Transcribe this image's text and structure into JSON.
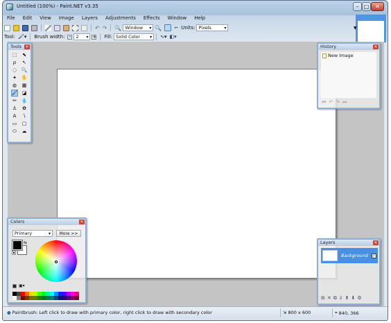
{
  "window": {
    "title": "Untitled (100%) - Paint.NET v3.35",
    "min_glyph": "–",
    "max_glyph": "□",
    "close_glyph": "✕"
  },
  "menubar": {
    "items": [
      "File",
      "Edit",
      "View",
      "Image",
      "Layers",
      "Adjustments",
      "Effects",
      "Window",
      "Help"
    ]
  },
  "toolbar1": {
    "zoom_value": "Window",
    "units_label": "Units:",
    "units_value": "Pixels"
  },
  "toolbar2": {
    "tool_label": "Tool:",
    "brush_width_label": "Brush width:",
    "brush_width_value": "2",
    "fill_label": "Fill:",
    "fill_value": "Solid Color"
  },
  "tools_panel": {
    "title": "Tools",
    "tools": [
      {
        "name": "rectangle-select-icon",
        "glyph": "⬚"
      },
      {
        "name": "move-selection-icon",
        "glyph": "⬉"
      },
      {
        "name": "lasso-select-icon",
        "glyph": "ρ"
      },
      {
        "name": "move-selection-alt-icon",
        "glyph": "↖"
      },
      {
        "name": "ellipse-select-icon",
        "glyph": "◌"
      },
      {
        "name": "zoom-icon",
        "glyph": "🔍"
      },
      {
        "name": "magic-wand-icon",
        "glyph": "✦"
      },
      {
        "name": "pan-icon",
        "glyph": "✋"
      },
      {
        "name": "paint-bucket-icon",
        "glyph": "◍"
      },
      {
        "name": "gradient-icon",
        "glyph": "▦"
      },
      {
        "name": "paintbrush-icon",
        "glyph": "🖌"
      },
      {
        "name": "eraser-icon",
        "glyph": "◪"
      },
      {
        "name": "pencil-icon",
        "glyph": "✏"
      },
      {
        "name": "color-picker-icon",
        "glyph": "💧"
      },
      {
        "name": "clone-stamp-icon",
        "glyph": "♙"
      },
      {
        "name": "recolor-icon",
        "glyph": "✿"
      },
      {
        "name": "text-icon",
        "glyph": "A"
      },
      {
        "name": "line-curve-icon",
        "glyph": "∖"
      },
      {
        "name": "rectangle-icon",
        "glyph": "▭"
      },
      {
        "name": "rounded-rectangle-icon",
        "glyph": "▢"
      },
      {
        "name": "ellipse-icon",
        "glyph": "⬭"
      },
      {
        "name": "freeform-shape-icon",
        "glyph": "☁"
      }
    ],
    "active_tool": "paintbrush-icon"
  },
  "history_panel": {
    "title": "History",
    "items": [
      "New Image"
    ]
  },
  "colors_panel": {
    "title": "Colors",
    "mode_value": "Primary",
    "more_label": "More >>",
    "primary_color": "#000000",
    "secondary_color": "#ffffff",
    "palette": [
      "#000000",
      "#404040",
      "#ff0000",
      "#ff6a00",
      "#ffd800",
      "#b6ff00",
      "#4cff00",
      "#00ff21",
      "#00ff90",
      "#00ffff",
      "#0094ff",
      "#0026ff",
      "#4800ff",
      "#b200ff",
      "#ff00dc",
      "#ff006e",
      "#ffffff",
      "#808080",
      "#7f0000",
      "#7f3300",
      "#7f6a00",
      "#5b7f00",
      "#267f00",
      "#007f0e",
      "#007f46",
      "#007f7f",
      "#004a7f",
      "#00137f",
      "#21007f",
      "#57007f",
      "#7f006e",
      "#7f0037"
    ]
  },
  "layers_panel": {
    "title": "Layers",
    "layer_name": "Background"
  },
  "statusbar": {
    "message": "Paintbrush: Left click to draw with primary color, right click to draw with secondary color",
    "image_size": "800 x 600",
    "cursor_pos": "840, 366"
  }
}
